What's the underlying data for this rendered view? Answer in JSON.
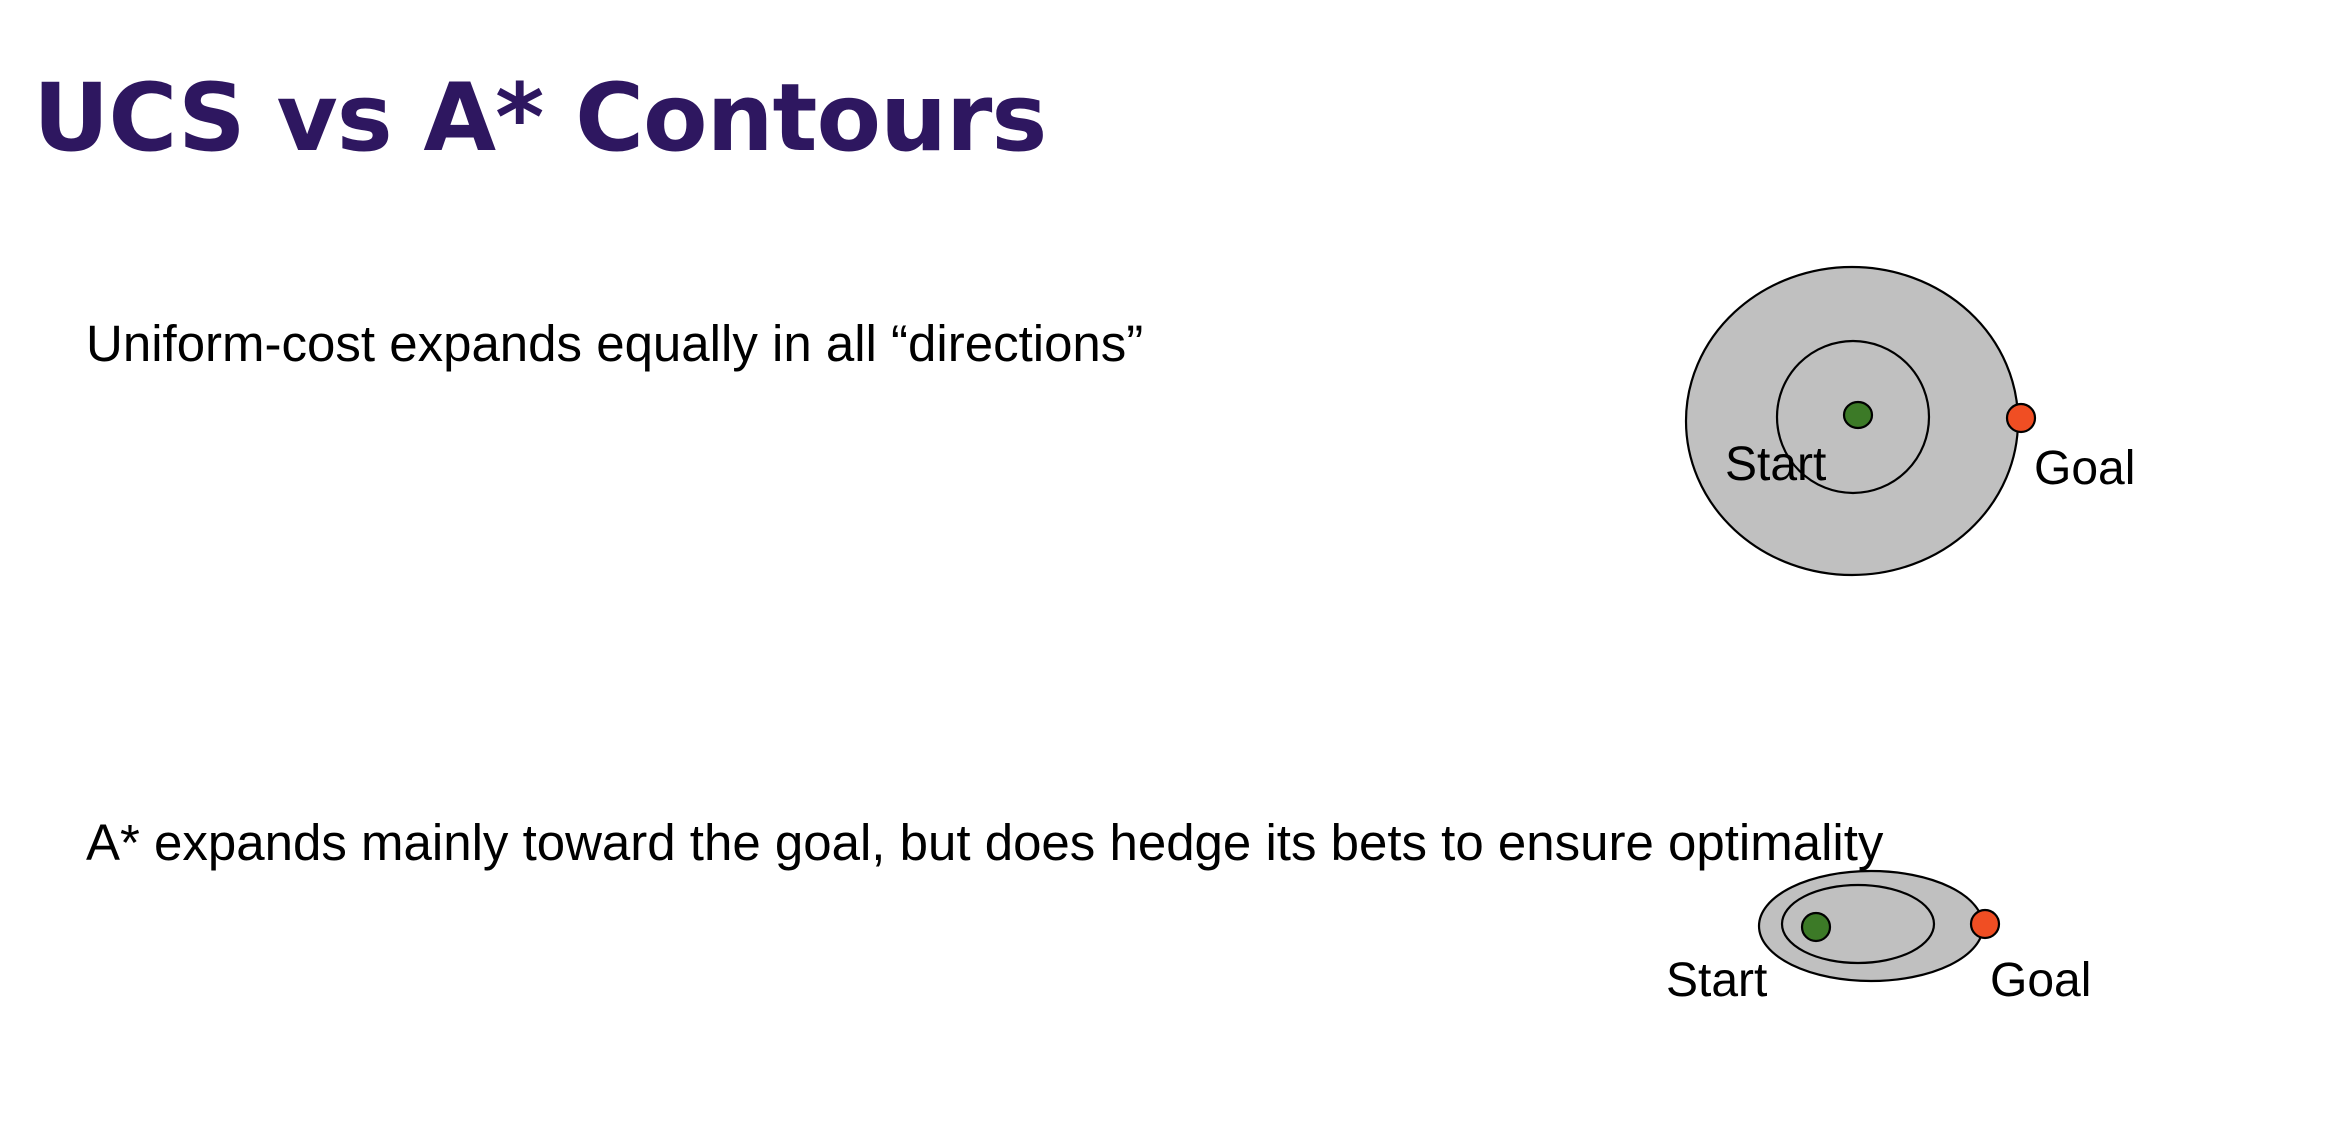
{
  "title": "UCS vs A* Contours",
  "ucs": {
    "caption": "Uniform-cost expands equally in all “directions”",
    "start_label": "Start",
    "goal_label": "Goal"
  },
  "astar": {
    "caption": "A* expands mainly toward the goal, but does hedge its bets to ensure optimality",
    "start_label": "Start",
    "goal_label": "Goal"
  },
  "colors": {
    "title": "#2e1760",
    "region_fill": "#c0c0c0",
    "start_node": "#3c7a27",
    "goal_node": "#f04e23"
  }
}
